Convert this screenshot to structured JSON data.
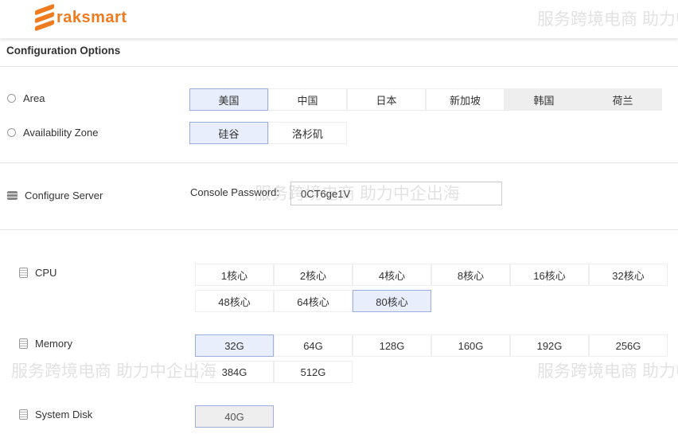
{
  "header": {
    "logo": "raksmart"
  },
  "title": "Configuration Options",
  "area": {
    "label": "Area",
    "options": [
      "美国",
      "中国",
      "日本",
      "新加坡",
      "韩国",
      "荷兰"
    ],
    "selected": 0,
    "disabled": [
      4,
      5
    ]
  },
  "zone": {
    "label": "Availability Zone",
    "options": [
      "硅谷",
      "洛杉矶"
    ],
    "selected": 0
  },
  "server": {
    "label": "Configure Server",
    "password_label": "Console Password:",
    "password_value": "0CT6ge1V"
  },
  "cpu": {
    "label": "CPU",
    "options": [
      "1核心",
      "2核心",
      "4核心",
      "8核心",
      "16核心",
      "32核心",
      "48核心",
      "64核心",
      "80核心"
    ],
    "selected": 8
  },
  "memory": {
    "label": "Memory",
    "options": [
      "32G",
      "64G",
      "128G",
      "160G",
      "192G",
      "256G",
      "384G",
      "512G"
    ],
    "selected": 0
  },
  "disk": {
    "label": "System Disk",
    "options": [
      "40G"
    ],
    "selected": 0
  },
  "watermark": "服务跨境电商 助力中企出海"
}
